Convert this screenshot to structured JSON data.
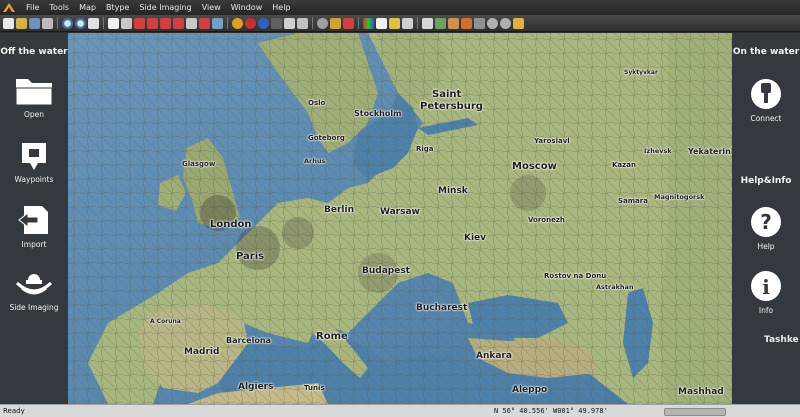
{
  "menu": [
    "File",
    "Tools",
    "Map",
    "Btype",
    "Side Imaging",
    "View",
    "Window",
    "Help"
  ],
  "left_panel": {
    "title": "Off the water",
    "buttons": [
      {
        "label": "Open",
        "icon": "folder-icon"
      },
      {
        "label": "Waypoints",
        "icon": "waypoint-icon"
      },
      {
        "label": "Import",
        "icon": "import-icon"
      },
      {
        "label": "Side Imaging",
        "icon": "side-imaging-icon"
      }
    ]
  },
  "right_panel": {
    "title": "On the water",
    "connect_label": "Connect",
    "help_title": "Help&Info",
    "help_label": "Help",
    "info_label": "Info"
  },
  "map": {
    "cities": {
      "saint": "Saint",
      "petersburg": "Petersburg",
      "stockholm": "Stockholm",
      "oslo": "Oslo",
      "riga": "Riga",
      "yaroslavl": "Yaroslavl",
      "kazan": "Kazan",
      "izhevsk": "Izhevsk",
      "yekaterinburg": "Yekaterinburg",
      "syktyvkar": "Syktyvkar",
      "moscow": "Moscow",
      "minsk": "Minsk",
      "samara": "Samara",
      "magnitogorsk": "Magnitogorsk",
      "voronezh": "Voronezh",
      "kiev": "Kiev",
      "warsaw": "Warsaw",
      "berlin": "Berlin",
      "goteborg": "Goteborg",
      "arhus": "Arhus",
      "glasgow": "Glasgow",
      "london": "London",
      "paris": "Paris",
      "budapest": "Budapest",
      "rostov": "Rostov na Donu",
      "astrakhan": "Astrakhan",
      "bucharest": "Bucharest",
      "rome": "Rome",
      "barcelona": "Barcelona",
      "madrid": "Madrid",
      "acoruna": "A Coruna",
      "ankara": "Ankara",
      "algiers": "Algiers",
      "tunis": "Tunis",
      "aleppo": "Aleppo",
      "mashhad": "Mashhad",
      "tashkent": "Tashke"
    }
  },
  "status": {
    "ready": "Ready",
    "coords": "N 56° 40.556' W001° 49.978'"
  }
}
